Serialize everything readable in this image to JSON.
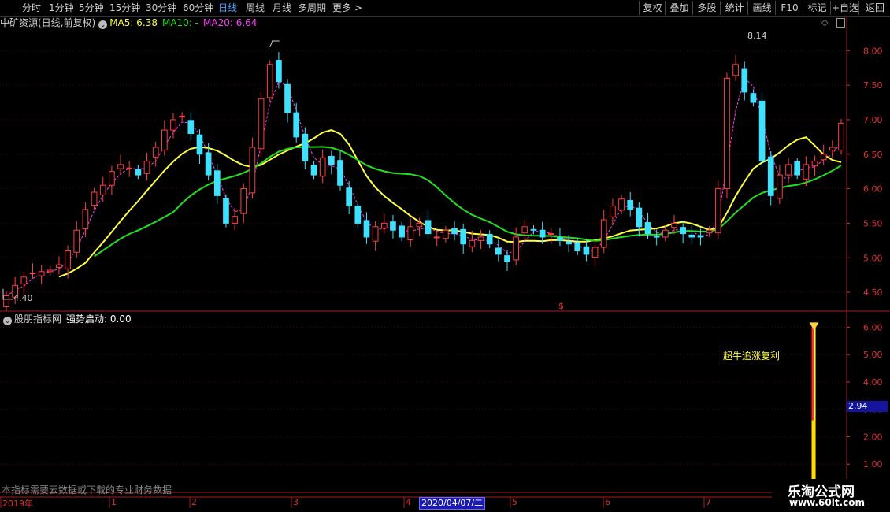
{
  "toolbar": {
    "periods": [
      "分时",
      "1分钟",
      "5分钟",
      "15分钟",
      "30分钟",
      "60分钟",
      "日线",
      "周线",
      "月线",
      "多周期",
      "更多 >"
    ],
    "active_period": "日线",
    "buttons": [
      "复权",
      "叠加",
      "多股",
      "统计",
      "画线",
      "F10",
      "标记",
      "+自选",
      "返回"
    ]
  },
  "main_info": {
    "stock": "中矿资源(日线,前复权)",
    "ma5": "MA5: 6.38",
    "ma10": "MA10: -",
    "ma20": "MA20: 6.64"
  },
  "sub_info": {
    "site": "股朋指标网",
    "indicator": "强势启动: 0.00"
  },
  "price_axis": [
    "8.00",
    "7.50",
    "7.00",
    "6.50",
    "6.00",
    "5.50",
    "5.00",
    "4.50"
  ],
  "indicator_axis": [
    "6.00",
    "5.00",
    "4.00",
    "3.00",
    "2.00",
    "1.00"
  ],
  "time_axis": [
    "2019年",
    "1",
    "2",
    "3",
    "4",
    "5",
    "6",
    "7"
  ],
  "annotations": {
    "high": "8.14",
    "low": "4.40",
    "signal_text": "超牛追涨复利",
    "dollar": "$"
  },
  "cursor": {
    "date": "2020/04/07/二",
    "value": "2.94"
  },
  "notice": "本指标需要云数据或下载的专业财务数据",
  "watermark": {
    "line1": "乐淘公式网",
    "line2": "www.60lt.com"
  },
  "colors": {
    "up": "#ff4040",
    "down": "#40e0ff",
    "ma5": "#ff40ff",
    "ma10": "#ffff40",
    "ma20": "#20e020",
    "axis": "#e03030"
  },
  "chart_data": {
    "type": "candlestick",
    "y_range": [
      4.25,
      8.3
    ],
    "indicator_range": [
      0,
      6.3
    ],
    "closes": [
      4.45,
      4.6,
      4.72,
      4.78,
      4.8,
      4.82,
      4.9,
      5.1,
      5.4,
      5.7,
      5.95,
      6.05,
      6.25,
      6.35,
      6.3,
      6.2,
      6.4,
      6.6,
      6.85,
      7.0,
      7.05,
      6.8,
      6.5,
      6.2,
      5.9,
      5.5,
      5.6,
      6.0,
      6.6,
      7.3,
      7.8,
      7.55,
      7.1,
      6.75,
      6.4,
      6.2,
      6.45,
      6.35,
      6.05,
      5.75,
      5.5,
      5.3,
      5.45,
      5.5,
      5.4,
      5.3,
      5.45,
      5.5,
      5.35,
      5.3,
      5.4,
      5.35,
      5.2,
      5.25,
      5.3,
      5.2,
      5.05,
      4.95,
      5.3,
      5.45,
      5.4,
      5.3,
      5.35,
      5.25,
      5.2,
      5.1,
      5.05,
      5.15,
      5.55,
      5.75,
      5.85,
      5.7,
      5.45,
      5.35,
      5.3,
      5.4,
      5.5,
      5.35,
      5.3,
      5.3,
      5.4,
      6.0,
      7.6,
      7.8,
      7.4,
      7.25,
      6.4,
      5.9,
      6.2,
      6.35,
      6.2,
      6.35,
      6.4,
      6.5,
      6.6,
      6.95
    ],
    "signal": {
      "index": 92,
      "value": 6.0
    }
  }
}
